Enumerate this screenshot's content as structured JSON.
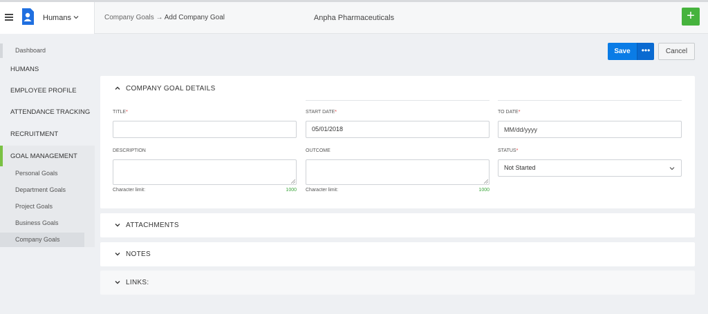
{
  "topbar": {
    "module": "Humans",
    "breadcrumb": {
      "parent": "Company Goals",
      "separator": "→",
      "current": "Add Company Goal"
    },
    "company": "Anpha Pharmaceuticals",
    "add_icon": "plus-icon",
    "accent": "#46b33d"
  },
  "sidebar": {
    "dashboard": "Dashboard",
    "sections": [
      "HUMANS",
      "EMPLOYEE PROFILE",
      "ATTENDANCE TRACKING",
      "RECRUITMENT",
      "GOAL MANAGEMENT"
    ],
    "goal_items": [
      "Personal Goals",
      "Department Goals",
      "Project Goals",
      "Business Goals",
      "Company Goals"
    ],
    "active_item": "Company Goals"
  },
  "actions": {
    "save": "Save",
    "more": "•••",
    "cancel": "Cancel",
    "primary_color": "#0a7ce6"
  },
  "details": {
    "heading": "COMPANY GOAL DETAILS",
    "title_label": "TITLE",
    "title_value": "",
    "start_label": "START DATE",
    "start_value": "05/01/2018",
    "to_label": "TO DATE",
    "to_placeholder": "MM/dd/yyyy",
    "description_label": "DESCRIPTION",
    "outcome_label": "OUTCOME",
    "status_label": "STATUS",
    "status_value": "Not Started",
    "required_mark": "*",
    "char_limit_label": "Character limit:",
    "char_limit_value": "1000"
  },
  "sections": {
    "attachments": "ATTACHMENTS",
    "notes": "NOTES",
    "links": "LINKS:"
  }
}
